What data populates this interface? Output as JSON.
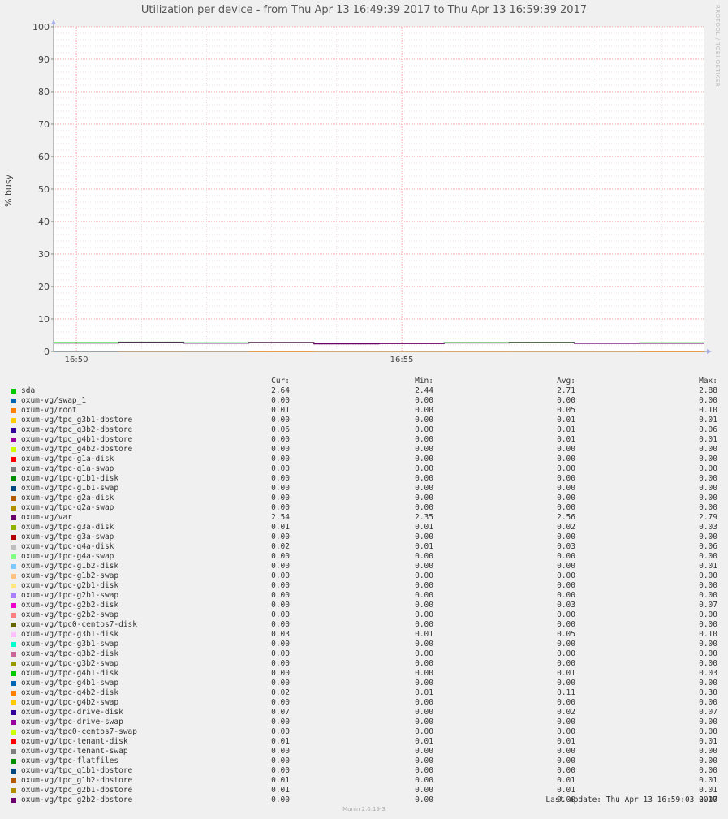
{
  "title": "Utilization per device - from Thu Apr 13 16:49:39 2017 to Thu Apr 13 16:59:39 2017",
  "watermark": "RRDTOOL / TOBI OETIKER",
  "version": "Munin 2.0.19-3",
  "last_update": "Last update:  Thu Apr 13 16:59:03 2017",
  "legend_headers": {
    "cur": "Cur:",
    "min": "Min:",
    "avg": "Avg:",
    "max": "Max:"
  },
  "colors": {
    "background": "#f0f0f0",
    "plot_bg": "#ffffff",
    "grid_minor": "#e4c8c8",
    "grid_major": "#ef9090",
    "axis": "#888888"
  },
  "chart_data": {
    "type": "line",
    "title": "Utilization per device - from Thu Apr 13 16:49:39 2017 to Thu Apr 13 16:59:39 2017",
    "xlabel": "",
    "ylabel": "% busy",
    "ylim": [
      0,
      100
    ],
    "yticks": [
      0,
      10,
      20,
      30,
      40,
      50,
      60,
      70,
      80,
      90,
      100
    ],
    "xlim": [
      "16:49:39",
      "16:59:39"
    ],
    "x": [
      "16:49:39",
      "16:50:39",
      "16:51:39",
      "16:52:39",
      "16:53:39",
      "16:54:39",
      "16:55:39",
      "16:56:39",
      "16:57:39",
      "16:58:39",
      "16:59:39"
    ],
    "xticks": [
      "16:50",
      "16:55"
    ],
    "grid": true,
    "series": [
      {
        "name": "sda",
        "color": "#00cc00",
        "values": [
          2.7,
          2.88,
          2.66,
          2.78,
          2.44,
          2.56,
          2.72,
          2.82,
          2.58,
          2.64,
          null
        ],
        "cur": "2.64",
        "min": "2.44",
        "avg": "2.71",
        "max": "2.88"
      },
      {
        "name": "oxum-vg/swap_1",
        "color": "#0066b3",
        "values": [
          0,
          0,
          0,
          0,
          0,
          0,
          0,
          0,
          0,
          0,
          null
        ],
        "cur": "0.00",
        "min": "0.00",
        "avg": "0.00",
        "max": "0.00"
      },
      {
        "name": "oxum-vg/root",
        "color": "#ff8000",
        "values": [
          0.1,
          0.08,
          0.06,
          0.02,
          0.03,
          0.04,
          0.05,
          0.04,
          0.03,
          0.01,
          null
        ],
        "cur": "0.01",
        "min": "0.00",
        "avg": "0.05",
        "max": "0.10"
      },
      {
        "name": "oxum-vg/tpc_g3b1-dbstore",
        "color": "#ffcc00",
        "cur": "0.00",
        "min": "0.00",
        "avg": "0.01",
        "max": "0.01"
      },
      {
        "name": "oxum-vg/tpc_g3b2-dbstore",
        "color": "#330099",
        "cur": "0.06",
        "min": "0.00",
        "avg": "0.01",
        "max": "0.06"
      },
      {
        "name": "oxum-vg/tpc_g4b1-dbstore",
        "color": "#990099",
        "cur": "0.00",
        "min": "0.00",
        "avg": "0.01",
        "max": "0.01"
      },
      {
        "name": "oxum-vg/tpc_g4b2-dbstore",
        "color": "#ccff00",
        "cur": "0.00",
        "min": "0.00",
        "avg": "0.00",
        "max": "0.00"
      },
      {
        "name": "oxum-vg/tpc-g1a-disk",
        "color": "#ff0000",
        "cur": "0.00",
        "min": "0.00",
        "avg": "0.00",
        "max": "0.00"
      },
      {
        "name": "oxum-vg/tpc-g1a-swap",
        "color": "#808080",
        "cur": "0.00",
        "min": "0.00",
        "avg": "0.00",
        "max": "0.00"
      },
      {
        "name": "oxum-vg/tpc-g1b1-disk",
        "color": "#008f00",
        "cur": "0.00",
        "min": "0.00",
        "avg": "0.00",
        "max": "0.00"
      },
      {
        "name": "oxum-vg/tpc-g1b1-swap",
        "color": "#00487d",
        "cur": "0.00",
        "min": "0.00",
        "avg": "0.00",
        "max": "0.00"
      },
      {
        "name": "oxum-vg/tpc-g2a-disk",
        "color": "#b35a00",
        "cur": "0.00",
        "min": "0.00",
        "avg": "0.00",
        "max": "0.00"
      },
      {
        "name": "oxum-vg/tpc-g2a-swap",
        "color": "#b38f00",
        "cur": "0.00",
        "min": "0.00",
        "avg": "0.00",
        "max": "0.00"
      },
      {
        "name": "oxum-vg/var",
        "color": "#6b006b",
        "values": [
          2.6,
          2.79,
          2.58,
          2.74,
          2.35,
          2.45,
          2.62,
          2.7,
          2.5,
          2.54,
          null
        ],
        "cur": "2.54",
        "min": "2.35",
        "avg": "2.56",
        "max": "2.79"
      },
      {
        "name": "oxum-vg/tpc-g3a-disk",
        "color": "#8fb300",
        "cur": "0.01",
        "min": "0.01",
        "avg": "0.02",
        "max": "0.03"
      },
      {
        "name": "oxum-vg/tpc-g3a-swap",
        "color": "#b30000",
        "cur": "0.00",
        "min": "0.00",
        "avg": "0.00",
        "max": "0.00"
      },
      {
        "name": "oxum-vg/tpc-g4a-disk",
        "color": "#bebebe",
        "cur": "0.02",
        "min": "0.01",
        "avg": "0.03",
        "max": "0.06"
      },
      {
        "name": "oxum-vg/tpc-g4a-swap",
        "color": "#80ff80",
        "cur": "0.00",
        "min": "0.00",
        "avg": "0.00",
        "max": "0.00"
      },
      {
        "name": "oxum-vg/tpc-g1b2-disk",
        "color": "#80c9ff",
        "cur": "0.00",
        "min": "0.00",
        "avg": "0.00",
        "max": "0.01"
      },
      {
        "name": "oxum-vg/tpc-g1b2-swap",
        "color": "#ffc080",
        "cur": "0.00",
        "min": "0.00",
        "avg": "0.00",
        "max": "0.00"
      },
      {
        "name": "oxum-vg/tpc-g2b1-disk",
        "color": "#ffe680",
        "cur": "0.00",
        "min": "0.00",
        "avg": "0.00",
        "max": "0.00"
      },
      {
        "name": "oxum-vg/tpc-g2b1-swap",
        "color": "#aa80ff",
        "cur": "0.00",
        "min": "0.00",
        "avg": "0.00",
        "max": "0.00"
      },
      {
        "name": "oxum-vg/tpc-g2b2-disk",
        "color": "#ee00cc",
        "cur": "0.00",
        "min": "0.00",
        "avg": "0.03",
        "max": "0.07"
      },
      {
        "name": "oxum-vg/tpc-g2b2-swap",
        "color": "#ff8080",
        "cur": "0.00",
        "min": "0.00",
        "avg": "0.00",
        "max": "0.00"
      },
      {
        "name": "oxum-vg/tpc0-centos7-disk",
        "color": "#666600",
        "cur": "0.00",
        "min": "0.00",
        "avg": "0.00",
        "max": "0.00"
      },
      {
        "name": "oxum-vg/tpc-g3b1-disk",
        "color": "#ffbfff",
        "cur": "0.03",
        "min": "0.01",
        "avg": "0.05",
        "max": "0.10"
      },
      {
        "name": "oxum-vg/tpc-g3b1-swap",
        "color": "#00ffcc",
        "cur": "0.00",
        "min": "0.00",
        "avg": "0.00",
        "max": "0.00"
      },
      {
        "name": "oxum-vg/tpc-g3b2-disk",
        "color": "#cc6699",
        "cur": "0.00",
        "min": "0.00",
        "avg": "0.00",
        "max": "0.00"
      },
      {
        "name": "oxum-vg/tpc-g3b2-swap",
        "color": "#999900",
        "cur": "0.00",
        "min": "0.00",
        "avg": "0.00",
        "max": "0.00"
      },
      {
        "name": "oxum-vg/tpc-g4b1-disk",
        "color": "#00cc00",
        "cur": "0.00",
        "min": "0.00",
        "avg": "0.01",
        "max": "0.03"
      },
      {
        "name": "oxum-vg/tpc-g4b1-swap",
        "color": "#0066b3",
        "cur": "0.00",
        "min": "0.00",
        "avg": "0.00",
        "max": "0.00"
      },
      {
        "name": "oxum-vg/tpc-g4b2-disk",
        "color": "#ff8000",
        "cur": "0.02",
        "min": "0.01",
        "avg": "0.11",
        "max": "0.30"
      },
      {
        "name": "oxum-vg/tpc-g4b2-swap",
        "color": "#ffcc00",
        "cur": "0.00",
        "min": "0.00",
        "avg": "0.00",
        "max": "0.00"
      },
      {
        "name": "oxum-vg/tpc-drive-disk",
        "color": "#330099",
        "cur": "0.07",
        "min": "0.00",
        "avg": "0.02",
        "max": "0.07"
      },
      {
        "name": "oxum-vg/tpc-drive-swap",
        "color": "#990099",
        "cur": "0.00",
        "min": "0.00",
        "avg": "0.00",
        "max": "0.00"
      },
      {
        "name": "oxum-vg/tpc0-centos7-swap",
        "color": "#ccff00",
        "cur": "0.00",
        "min": "0.00",
        "avg": "0.00",
        "max": "0.00"
      },
      {
        "name": "oxum-vg/tpc-tenant-disk",
        "color": "#ff0000",
        "cur": "0.01",
        "min": "0.01",
        "avg": "0.01",
        "max": "0.01"
      },
      {
        "name": "oxum-vg/tpc-tenant-swap",
        "color": "#808080",
        "cur": "0.00",
        "min": "0.00",
        "avg": "0.00",
        "max": "0.00"
      },
      {
        "name": "oxum-vg/tpc-flatfiles",
        "color": "#008f00",
        "cur": "0.00",
        "min": "0.00",
        "avg": "0.00",
        "max": "0.00"
      },
      {
        "name": "oxum-vg/tpc_g1b1-dbstore",
        "color": "#00487d",
        "cur": "0.00",
        "min": "0.00",
        "avg": "0.00",
        "max": "0.00"
      },
      {
        "name": "oxum-vg/tpc_g1b2-dbstore",
        "color": "#b35a00",
        "cur": "0.01",
        "min": "0.00",
        "avg": "0.01",
        "max": "0.01"
      },
      {
        "name": "oxum-vg/tpc_g2b1-dbstore",
        "color": "#b38f00",
        "cur": "0.01",
        "min": "0.00",
        "avg": "0.01",
        "max": "0.01"
      },
      {
        "name": "oxum-vg/tpc_g2b2-dbstore",
        "color": "#6b006b",
        "cur": "0.00",
        "min": "0.00",
        "avg": "0.00",
        "max": "0.00"
      }
    ]
  }
}
